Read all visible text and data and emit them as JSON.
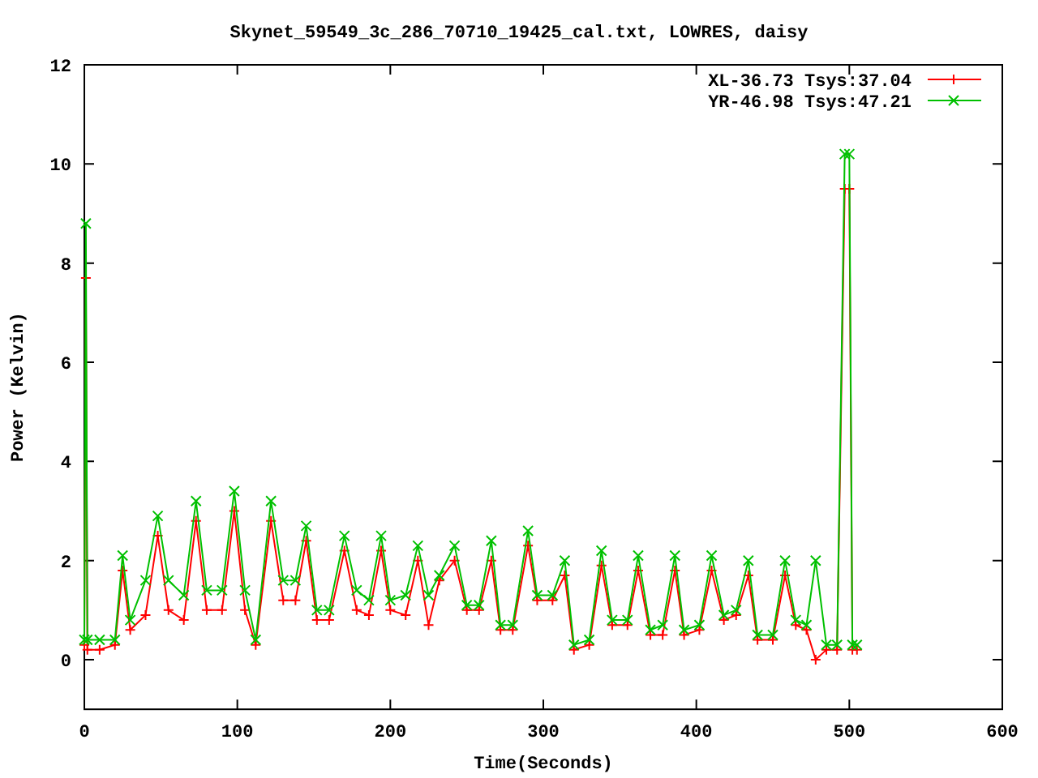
{
  "chart_data": {
    "type": "line",
    "title": "Skynet_59549_3c_286_70710_19425_cal.txt, LOWRES, daisy",
    "xlabel": "Time(Seconds)",
    "ylabel": "Power (Kelvin)",
    "xlim": [
      0,
      600
    ],
    "ylim": [
      -1,
      12
    ],
    "xticks": [
      0,
      100,
      200,
      300,
      400,
      500,
      600
    ],
    "yticks": [
      0,
      2,
      4,
      6,
      8,
      10,
      12
    ],
    "legend": true,
    "x": [
      0,
      1,
      2,
      10,
      20,
      25,
      30,
      40,
      48,
      55,
      65,
      73,
      80,
      90,
      98,
      105,
      112,
      122,
      130,
      138,
      145,
      152,
      160,
      170,
      178,
      186,
      194,
      200,
      210,
      218,
      225,
      232,
      242,
      250,
      258,
      266,
      272,
      280,
      290,
      296,
      306,
      314,
      320,
      330,
      338,
      345,
      355,
      362,
      370,
      378,
      386,
      392,
      402,
      410,
      418,
      426,
      434,
      440,
      450,
      458,
      465,
      472,
      478,
      485,
      492,
      497,
      500,
      502,
      505
    ],
    "series": [
      {
        "name": "XL-36.73 Tsys:37.04",
        "color": "#ff0000",
        "marker": "plus",
        "values": [
          0.3,
          7.7,
          0.2,
          0.2,
          0.3,
          1.8,
          0.6,
          0.9,
          2.5,
          1.0,
          0.8,
          2.8,
          1.0,
          1.0,
          3.0,
          1.0,
          0.3,
          2.8,
          1.2,
          1.2,
          2.4,
          0.8,
          0.8,
          2.2,
          1.0,
          0.9,
          2.2,
          1.0,
          0.9,
          2.0,
          0.7,
          1.6,
          2.0,
          1.0,
          1.0,
          2.0,
          0.6,
          0.6,
          2.3,
          1.2,
          1.2,
          1.7,
          0.2,
          0.3,
          1.9,
          0.7,
          0.7,
          1.8,
          0.5,
          0.5,
          1.8,
          0.5,
          0.6,
          1.8,
          0.8,
          0.9,
          1.7,
          0.4,
          0.4,
          1.7,
          0.7,
          0.6,
          0.0,
          0.2,
          0.2,
          9.5,
          9.5,
          0.2,
          0.2
        ]
      },
      {
        "name": "YR-46.98 Tsys:47.21",
        "color": "#00c000",
        "marker": "cross",
        "values": [
          0.4,
          8.8,
          0.4,
          0.4,
          0.4,
          2.1,
          0.8,
          1.6,
          2.9,
          1.6,
          1.3,
          3.2,
          1.4,
          1.4,
          3.4,
          1.4,
          0.4,
          3.2,
          1.6,
          1.6,
          2.7,
          1.0,
          1.0,
          2.5,
          1.4,
          1.2,
          2.5,
          1.2,
          1.3,
          2.3,
          1.3,
          1.7,
          2.3,
          1.1,
          1.1,
          2.4,
          0.7,
          0.7,
          2.6,
          1.3,
          1.3,
          2.0,
          0.3,
          0.4,
          2.2,
          0.8,
          0.8,
          2.1,
          0.6,
          0.7,
          2.1,
          0.6,
          0.7,
          2.1,
          0.9,
          1.0,
          2.0,
          0.5,
          0.5,
          2.0,
          0.8,
          0.7,
          2.0,
          0.3,
          0.3,
          10.2,
          10.2,
          0.3,
          0.3
        ]
      }
    ]
  }
}
